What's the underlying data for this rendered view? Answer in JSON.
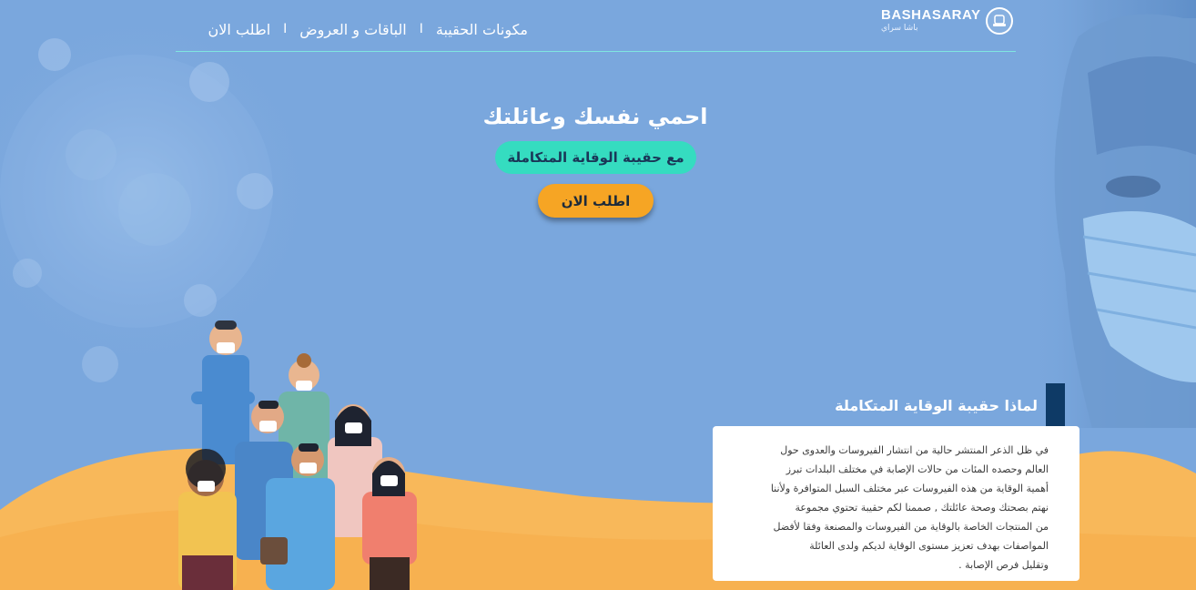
{
  "colors": {
    "background": "#7aa7dd",
    "accent_teal": "#35dcc0",
    "accent_orange": "#f6a524",
    "sand": "#f8b85a",
    "navy": "#0e3a66"
  },
  "logo": {
    "name": "BASHASARAY",
    "subtitle": "باشا سراي",
    "icon": "hat-icon"
  },
  "nav": {
    "items": [
      {
        "label": "مكونات الحقيبة"
      },
      {
        "label": "الباقات و العروض"
      },
      {
        "label": "اطلب الان"
      }
    ],
    "separator": "I"
  },
  "hero": {
    "title": "احمي نفسك وعائلتك",
    "subtitle": "مع حقيبة الوقاية المتكاملة",
    "cta": "اطلب الان"
  },
  "why": {
    "title": "لماذا حقيبة الوقاية المتكاملة",
    "lines": [
      "في ظل الذعر المنتشر حالية من انتشار الفيروسات والعدوى حول",
      "العالم وحصده المئات من حالات الإصابة في مختلف البلدات تبرز",
      "أهمية الوقاية من هذه الفيروسات عبر مختلف السبل المتوافرة ولأننا",
      "نهتم بصحتك وصحة عائلتك , صممنا لكم حقيبة تحتوي مجموعة",
      "من المنتجات الخاصة بالوقاية من الفيروسات والمصنعة وفقا لأفضل",
      "المواصفات بهدف تعزيز مستوى الوقاية لديكم ولدى العائلة",
      "وتقليل فرص الإصابة ."
    ]
  },
  "illustrations": {
    "virus": "virus-illustration",
    "man": "masked-man-photo",
    "people": "masked-people-illustration"
  }
}
